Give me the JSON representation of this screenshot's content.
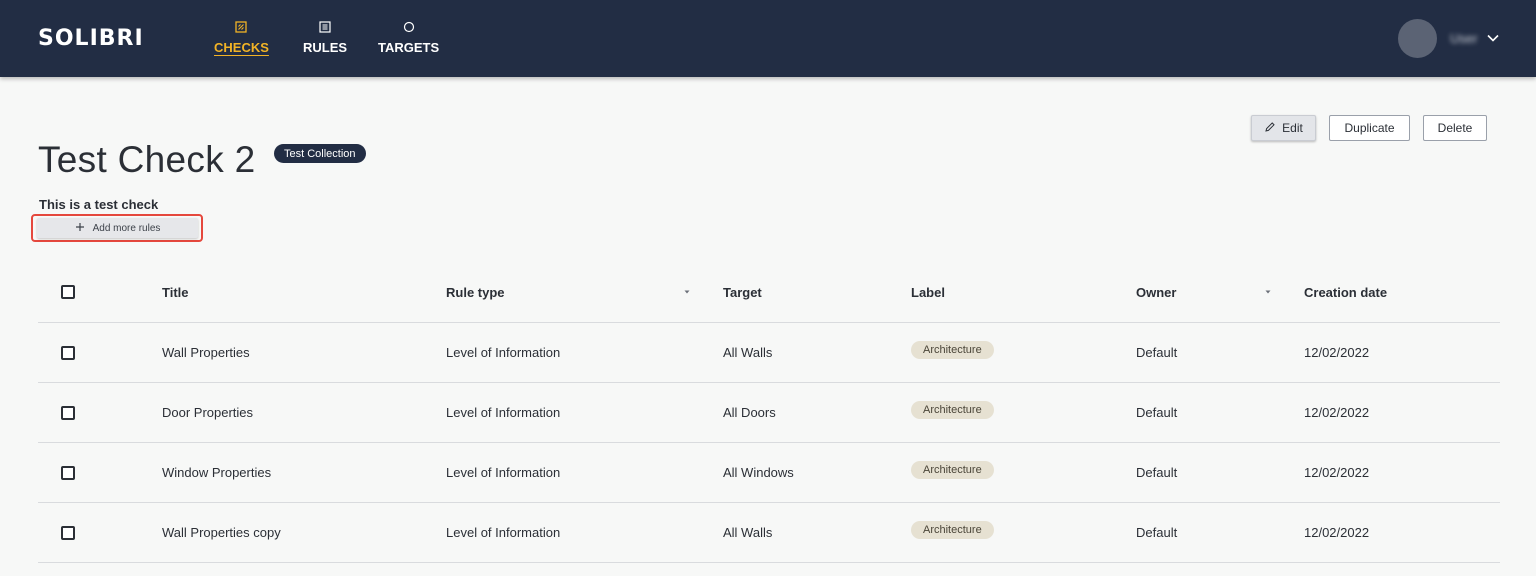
{
  "app": {
    "logo": "SOLIBRI",
    "nav": [
      {
        "label": "CHECKS",
        "icon": "checks-icon",
        "active": true
      },
      {
        "label": "RULES",
        "icon": "rules-icon",
        "active": false
      },
      {
        "label": "TARGETS",
        "icon": "targets-icon",
        "active": false
      }
    ],
    "user": {
      "name": "User",
      "avatar_icon": "avatar",
      "menu_icon": "chevron-down-icon"
    }
  },
  "actions": {
    "edit_label": "Edit",
    "edit_icon": "pencil-icon",
    "duplicate_label": "Duplicate",
    "delete_label": "Delete"
  },
  "check": {
    "title": "Test Check 2",
    "collection": "Test Collection",
    "description": "This is a test check",
    "add_rules_label": "Add more rules",
    "add_rules_icon": "plus-icon"
  },
  "table": {
    "columns": {
      "title": "Title",
      "rule_type": "Rule type",
      "target": "Target",
      "label": "Label",
      "owner": "Owner",
      "creation_date": "Creation date"
    },
    "rows": [
      {
        "title": "Wall Properties",
        "rule_type": "Level of Information",
        "target": "All Walls",
        "label": "Architecture",
        "owner": "Default",
        "creation_date": "12/02/2022"
      },
      {
        "title": "Door Properties",
        "rule_type": "Level of Information",
        "target": "All Doors",
        "label": "Architecture",
        "owner": "Default",
        "creation_date": "12/02/2022"
      },
      {
        "title": "Window Properties",
        "rule_type": "Level of Information",
        "target": "All Windows",
        "label": "Architecture",
        "owner": "Default",
        "creation_date": "12/02/2022"
      },
      {
        "title": "Wall Properties copy",
        "rule_type": "Level of Information",
        "target": "All Walls",
        "label": "Architecture",
        "owner": "Default",
        "creation_date": "12/02/2022"
      }
    ]
  },
  "colors": {
    "header_bg": "#222d44",
    "active_nav": "#f2b326",
    "highlight_outline": "#e5483d",
    "label_pill_bg": "#e6e1d2",
    "page_bg": "#f7f8f7"
  }
}
